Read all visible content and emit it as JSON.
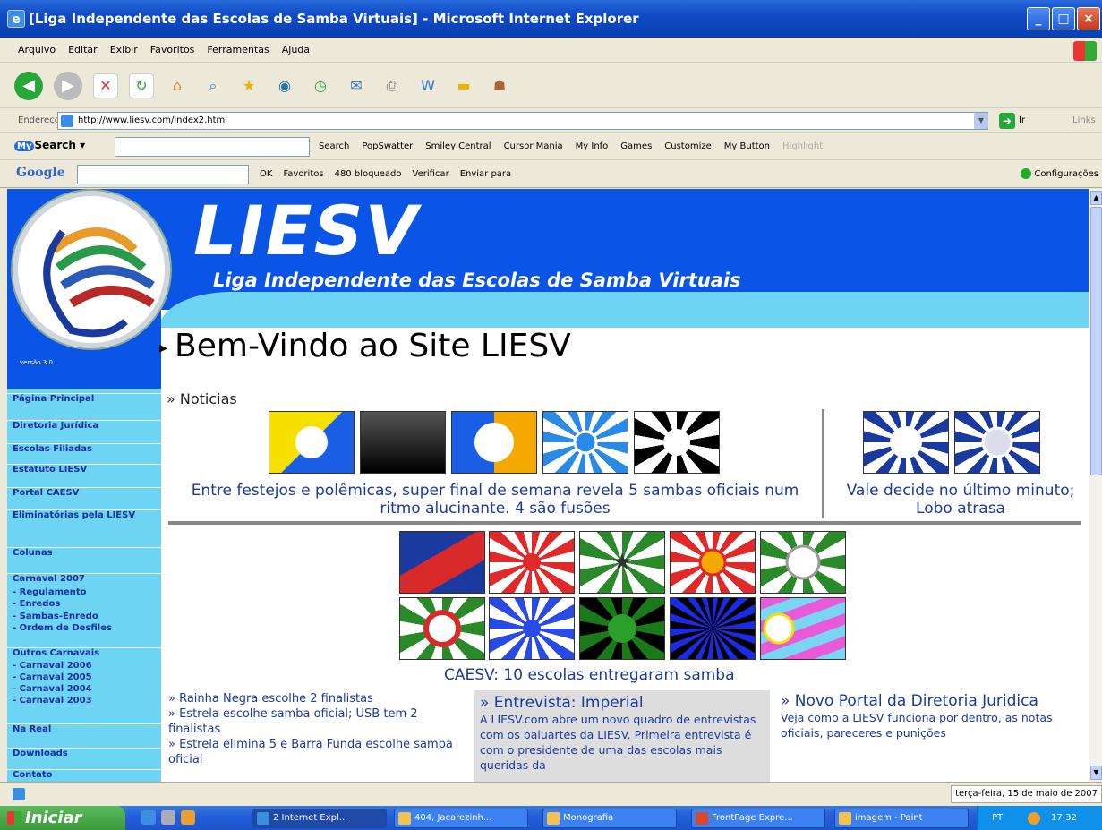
{
  "window": {
    "title": "[Liga Independente das Escolas de Samba Virtuais] - Microsoft Internet Explorer"
  },
  "menu": [
    "Arquivo",
    "Editar",
    "Exibir",
    "Favoritos",
    "Ferramentas",
    "Ajuda"
  ],
  "address": {
    "label": "Endereço",
    "url": "http://www.liesv.com/index2.html",
    "go": "Ir",
    "links": "Links"
  },
  "mysearch": {
    "brand": "Search",
    "items": [
      "Search",
      "PopSwatter",
      "Smiley Central",
      "Cursor Mania",
      "My Info",
      "Games",
      "Customize",
      "My Button",
      "Highlight"
    ]
  },
  "google": {
    "logo": "Google",
    "items": [
      "OK",
      "Favoritos",
      "480 bloqueado",
      "Verificar",
      "Enviar para"
    ],
    "config": "Configurações"
  },
  "site": {
    "title": "LIESV",
    "subtitle": "Liga Independente das Escolas de Samba Virtuais",
    "version": "versão 3.0",
    "welcome": "Bem-Vindo ao Site LIESV",
    "noticias": "» Noticias",
    "headline1": "Entre festejos e polêmicas, super final de semana revela 5 sambas oficiais num ritmo alucinante. 4 são fusões",
    "headline2": "Vale decide no último minuto; Lobo atrasa",
    "caesv": "CAESV: 10 escolas entregaram samba",
    "news": [
      "» Rainha Negra escolhe 2 finalistas",
      "» Estrela escolhe samba oficial; USB tem 2 finalistas",
      "» Estrela elimina 5 e Barra Funda escolhe samba oficial"
    ],
    "interview_title": "» Entrevista: Imperial",
    "interview_text": "A LIESV.com abre um novo quadro de entrevistas com os baluartes da LIESV. Primeira entrevista é com o presidente de uma das escolas mais queridas da",
    "portal_title": "» Novo Portal da Diretoria Juridica",
    "portal_text": "Veja como a LIESV funciona por dentro, as notas oficiais, pareceres e punições"
  },
  "sidebar": [
    "Página Principal",
    "Diretoria Jurídica",
    "Escolas Filiadas",
    "Estatuto LIESV",
    "Portal CAESV",
    "Eliminatórias pela LIESV",
    "Colunas",
    "Carnaval 2007",
    "- Regulamento",
    "- Enredos",
    "- Sambas-Enredo",
    "- Ordem de Desfiles",
    "Outros Carnavais",
    "- Carnaval 2006",
    "- Carnaval 2005",
    "- Carnaval 2004",
    "- Carnaval 2003",
    "Na Real",
    "Downloads",
    "Contato"
  ],
  "status": {
    "date": "terça-feira, 15 de maio de 2007"
  },
  "taskbar": {
    "start": "Iniciar",
    "tasks": [
      "2 Internet Expl...",
      "404, Jacarezinh...",
      "Monografia",
      "FrontPage Expre...",
      "imagem - Paint"
    ],
    "lang": "PT",
    "time": "17:32"
  },
  "colors": {
    "banner": "#0a55e5",
    "sidebar": "#6dd4f4",
    "link": "#1a3aa0"
  }
}
